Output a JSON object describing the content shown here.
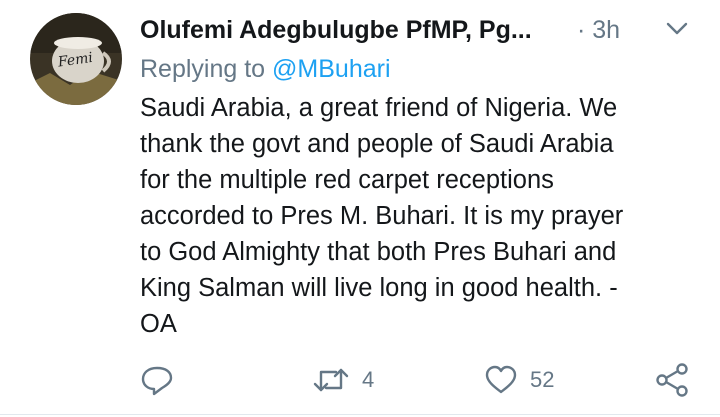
{
  "tweet": {
    "author": "Olufemi Adegbulugbe PfMP, Pg...",
    "time": "· 3h",
    "replying_prefix": "Replying to ",
    "replying_handle": "@MBuhari",
    "text": "Saudi Arabia, a great friend of Nigeria.  We\nthank the govt and people of Saudi Arabia\nfor the multiple red carpet receptions\naccorded to Pres M. Buhari.  It is my prayer\nto God Almighty that both Pres Buhari and\nKing Salman will live long in good health. -\nOA",
    "avatar_text": "Femi"
  },
  "actions": {
    "reply_count": "",
    "retweet_count": "4",
    "like_count": "52"
  },
  "icons": {
    "avatar": "profile-photo-mug",
    "caret": "chevron-down-icon",
    "reply": "reply-icon",
    "retweet": "retweet-icon",
    "like": "heart-icon",
    "share": "share-icon"
  },
  "colors": {
    "text": "#14171a",
    "secondary": "#657786",
    "link": "#1da1f2"
  }
}
